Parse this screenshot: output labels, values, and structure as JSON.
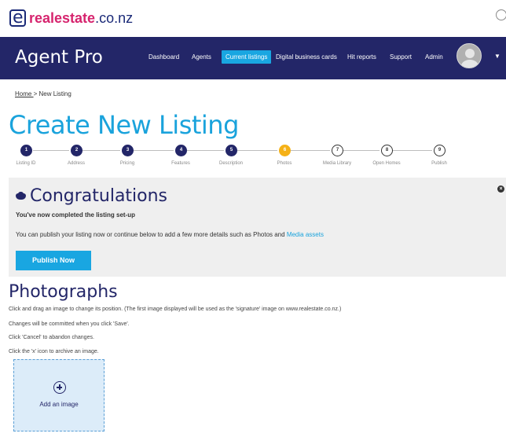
{
  "brand": {
    "name": "realestate",
    "domain": ".co.nz",
    "brand_color": "#d6246e",
    "navy": "#232668",
    "accent": "#19a6e1"
  },
  "header": {
    "app_title": "Agent Pro",
    "nav": [
      {
        "label": "Dashboard",
        "active": false
      },
      {
        "label": "Agents",
        "active": false
      },
      {
        "label": "Current listings",
        "active": true
      },
      {
        "label": "Digital business cards",
        "active": false
      },
      {
        "label": "Hit reports",
        "active": false
      },
      {
        "label": "Support",
        "active": false
      },
      {
        "label": "Admin",
        "active": false
      }
    ]
  },
  "breadcrumb": {
    "home": "Home ",
    "separator": " > ",
    "current": "New Listing"
  },
  "page_title": "Create New Listing",
  "stepper": {
    "steps": [
      {
        "num": "1",
        "label": "Listing ID",
        "state": "done"
      },
      {
        "num": "2",
        "label": "Address",
        "state": "done"
      },
      {
        "num": "3",
        "label": "Pricing",
        "state": "done"
      },
      {
        "num": "4",
        "label": "Features",
        "state": "done"
      },
      {
        "num": "5",
        "label": "Description",
        "state": "done"
      },
      {
        "num": "6",
        "label": "Photos",
        "state": "current"
      },
      {
        "num": "7",
        "label": "Media Library",
        "state": "todo"
      },
      {
        "num": "8",
        "label": "Open Homes",
        "state": "todo"
      },
      {
        "num": "9",
        "label": "Publish",
        "state": "todo"
      }
    ]
  },
  "congrats": {
    "title": "Congratulations",
    "subtitle": "You've now completed the listing set-up",
    "body_prefix": "You can publish your listing now or continue below to add a few more details such as Photos and ",
    "body_link": "Media assets",
    "publish_label": "Publish Now"
  },
  "photos": {
    "title": "Photographs",
    "instructions": [
      "Click and drag an image to change its position. (The first image displayed will be used as the 'signature' image on www.realestate.co.nz.)",
      "Changes will be committed when you click 'Save'.",
      "Click 'Cancel' to abandon changes.",
      "Click the 'x' icon to archive an image."
    ],
    "add_image_label": "Add an image"
  }
}
